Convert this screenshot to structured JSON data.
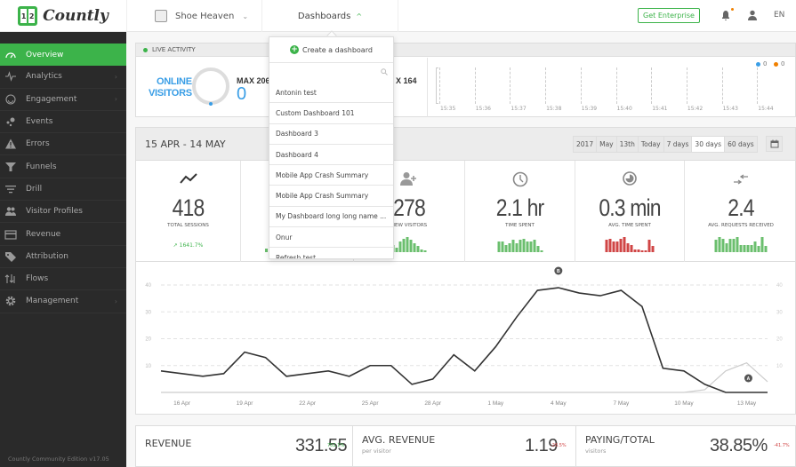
{
  "header": {
    "logo_text": "Countly",
    "app_name": "Shoe Heaven",
    "dashboards_label": "Dashboards",
    "get_enterprise": "Get Enterprise",
    "language": "EN"
  },
  "sidebar": {
    "items": [
      {
        "label": "Overview",
        "icon": "gauge-icon",
        "active": true
      },
      {
        "label": "Analytics",
        "icon": "pulse-icon",
        "submenu": true
      },
      {
        "label": "Engagement",
        "icon": "smile-icon",
        "submenu": true
      },
      {
        "label": "Events",
        "icon": "dots-icon"
      },
      {
        "label": "Errors",
        "icon": "warning-icon"
      },
      {
        "label": "Funnels",
        "icon": "funnel-icon"
      },
      {
        "label": "Drill",
        "icon": "filter-icon"
      },
      {
        "label": "Visitor Profiles",
        "icon": "users-icon"
      },
      {
        "label": "Revenue",
        "icon": "card-icon"
      },
      {
        "label": "Attribution",
        "icon": "tag-icon"
      },
      {
        "label": "Flows",
        "icon": "flows-icon"
      },
      {
        "label": "Management",
        "icon": "gear-icon",
        "submenu": true
      }
    ],
    "footer": "Countly Community Edition v17.05"
  },
  "live": {
    "title": "LIVE ACTIVITY",
    "online_label_1": "ONLINE",
    "online_label_2": "VISITORS",
    "max_1": "MAX 206",
    "current_1": "0",
    "max_2": "X 164",
    "legend": [
      {
        "value": "0",
        "color": "#3a9ee6"
      },
      {
        "value": "0",
        "color": "#f08000"
      }
    ],
    "times": [
      "15:35",
      "15:36",
      "15:37",
      "15:38",
      "15:39",
      "15:40",
      "15:41",
      "15:42",
      "15:43",
      "15:44"
    ]
  },
  "date": {
    "range": "15 APR - 14 MAY",
    "periods": [
      "2017",
      "May",
      "13th",
      "Today",
      "7 days",
      "30 days",
      "60 days"
    ],
    "selected_period": "30 days"
  },
  "cards": [
    {
      "value": "418",
      "label": "TOTAL SESSIONS",
      "trend": "1641.7%",
      "icon": "trend-line-icon"
    },
    {
      "value": "",
      "label": "",
      "icon": ""
    },
    {
      "value": "278",
      "label": "NEW VISITORS",
      "icon": "user-plus-icon",
      "spark": [
        5,
        3,
        7,
        9,
        10,
        8,
        6,
        4,
        2,
        1
      ],
      "color": "#6bbf6e"
    },
    {
      "value": "2.1 hr",
      "label": "TIME SPENT",
      "icon": "clock-icon",
      "spark": [
        7,
        7,
        5,
        6,
        8,
        6,
        8,
        9,
        7,
        7,
        8,
        4,
        1
      ],
      "color": "#6bbf6e"
    },
    {
      "value": "0.3 min",
      "label": "AVG. TIME SPENT",
      "icon": "pie-icon",
      "spark": [
        8,
        9,
        7,
        7,
        9,
        10,
        6,
        5,
        2,
        2,
        1,
        1,
        8,
        4
      ],
      "color": "#d04545"
    },
    {
      "value": "2.4",
      "label": "AVG. REQUESTS RECEIVED",
      "icon": "exchange-icon",
      "spark": [
        8,
        10,
        9,
        6,
        9,
        9,
        10,
        5,
        5,
        5,
        5,
        7,
        4,
        10,
        4
      ],
      "color": "#6bbf6e"
    }
  ],
  "chart_data": {
    "type": "line",
    "title": "",
    "xlabel": "",
    "ylabel": "",
    "ylim": [
      0,
      40
    ],
    "y_ticks": [
      10,
      20,
      30,
      40
    ],
    "x_tick_labels": [
      "16 Apr",
      "19 Apr",
      "22 Apr",
      "25 Apr",
      "28 Apr",
      "1 May",
      "4 May",
      "7 May",
      "10 May",
      "13 May"
    ],
    "x": [
      "15 Apr",
      "16 Apr",
      "17 Apr",
      "18 Apr",
      "19 Apr",
      "20 Apr",
      "21 Apr",
      "22 Apr",
      "23 Apr",
      "24 Apr",
      "25 Apr",
      "26 Apr",
      "27 Apr",
      "28 Apr",
      "29 Apr",
      "30 Apr",
      "1 May",
      "2 May",
      "3 May",
      "4 May",
      "5 May",
      "6 May",
      "7 May",
      "8 May",
      "9 May",
      "10 May",
      "11 May",
      "12 May",
      "13 May",
      "14 May"
    ],
    "series": [
      {
        "name": "current",
        "color": "#333333",
        "values": [
          8,
          7,
          6,
          7,
          15,
          13,
          6,
          7,
          8,
          6,
          10,
          10,
          3,
          5,
          14,
          8,
          17,
          28,
          38,
          39,
          37,
          36,
          38,
          32,
          9,
          8,
          3,
          0,
          0,
          0
        ]
      },
      {
        "name": "previous",
        "color": "#cccccc",
        "values": [
          0,
          0,
          0,
          0,
          0,
          0,
          0,
          0,
          0,
          0,
          0,
          0,
          0,
          0,
          0,
          0,
          0,
          0,
          0,
          0,
          0,
          0,
          0,
          0,
          0,
          0,
          1,
          8,
          11,
          4
        ]
      }
    ],
    "annotations": [
      {
        "label": "B",
        "x": "4 May"
      },
      {
        "label": "A",
        "x": "13 May"
      }
    ],
    "grid": true,
    "legend": "none"
  },
  "bottom": [
    {
      "title": "REVENUE",
      "sub": "",
      "value": "331.55",
      "pct": "752.1%",
      "pct_color": "#3cb34a"
    },
    {
      "title": "AVG. REVENUE",
      "sub": "per visitor",
      "value": "1.19",
      "pct": "-26.5%",
      "pct_color": "#d04545"
    },
    {
      "title": "PAYING/TOTAL",
      "sub": "visitors",
      "value": "38.85%",
      "pct": "-41.7%",
      "pct_color": "#d04545"
    }
  ],
  "dropdown": {
    "create_label": "Create a dashboard",
    "search_placeholder": "",
    "items": [
      "Antonin test",
      "Custom Dashboard 101",
      "Dashboard 3",
      "Dashboard 4",
      "Mobile App Crash Summary",
      "Mobile App Crash Summary",
      "My Dashboard long long name ...",
      "Onur",
      "Refresh test"
    ]
  }
}
